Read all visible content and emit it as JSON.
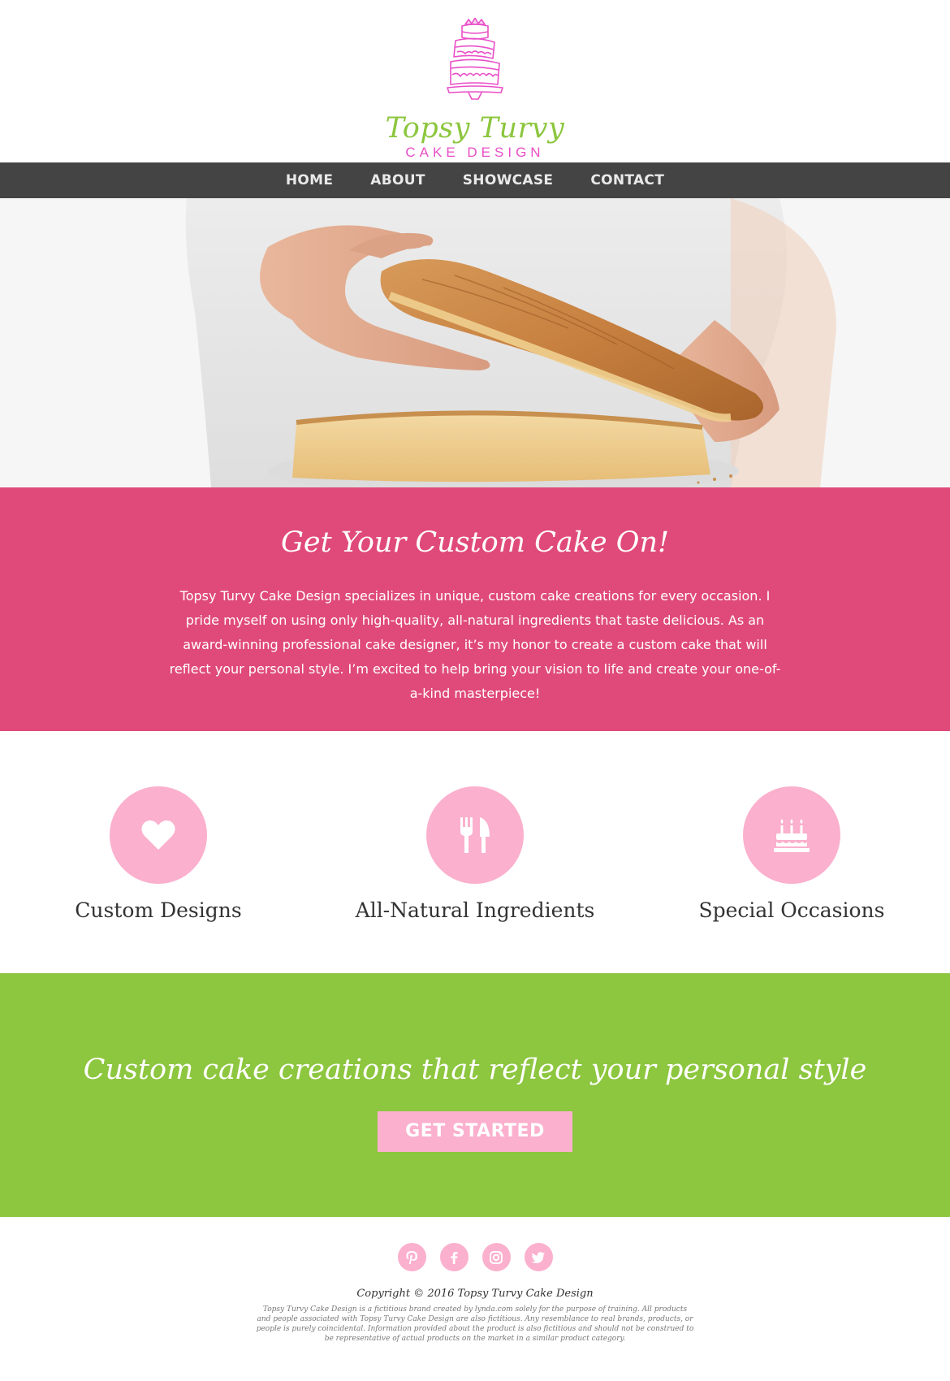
{
  "brand": {
    "name": "Topsy Turvy",
    "subtitle": "CAKE DESIGN",
    "logo_icon": "tiered-cake-icon",
    "colors": {
      "green": "#8cc63e",
      "pink": "#e94fc8",
      "rose": "#e04a7a",
      "light_pink": "#fbb0cd",
      "nav": "#444444"
    }
  },
  "nav": {
    "items": [
      {
        "label": "HOME"
      },
      {
        "label": "ABOUT"
      },
      {
        "label": "SHOWCASE"
      },
      {
        "label": "CONTACT"
      }
    ]
  },
  "hero": {
    "image": "hands-lifting-cake-layer"
  },
  "intro": {
    "heading": "Get Your Custom Cake On!",
    "body": "Topsy Turvy Cake Design specializes in unique, custom cake creations for every occasion. I pride myself on using only high-quality, all-natural ingredients that taste delicious. As an award-winning professional cake designer, it’s my honor to create a custom cake that will reflect your personal style. I’m excited to help bring your vision to life and create your one-of-a-kind masterpiece!"
  },
  "features": [
    {
      "label": "Custom Designs",
      "icon": "heart-icon"
    },
    {
      "label": "All-Natural Ingredients",
      "icon": "fork-knife-icon"
    },
    {
      "label": "Special Occasions",
      "icon": "birthday-cake-icon"
    }
  ],
  "cta": {
    "heading": "Custom cake creations that reflect your personal style",
    "button": "GET STARTED"
  },
  "footer": {
    "social": [
      "pinterest-icon",
      "facebook-icon",
      "instagram-icon",
      "twitter-icon"
    ],
    "copyright": "Copyright © 2016 Topsy Turvy Cake Design",
    "disclaimer": "Topsy Turvy Cake Design is a fictitious brand created by lynda.com solely for the purpose of training. All products and people associated with Topsy Turvy Cake Design are also fictitious. Any resemblance to real brands, products, or people is purely coincidental. Information provided about the product is also fictitious and should not be construed to be representative of actual products on the market in a similar product category."
  }
}
